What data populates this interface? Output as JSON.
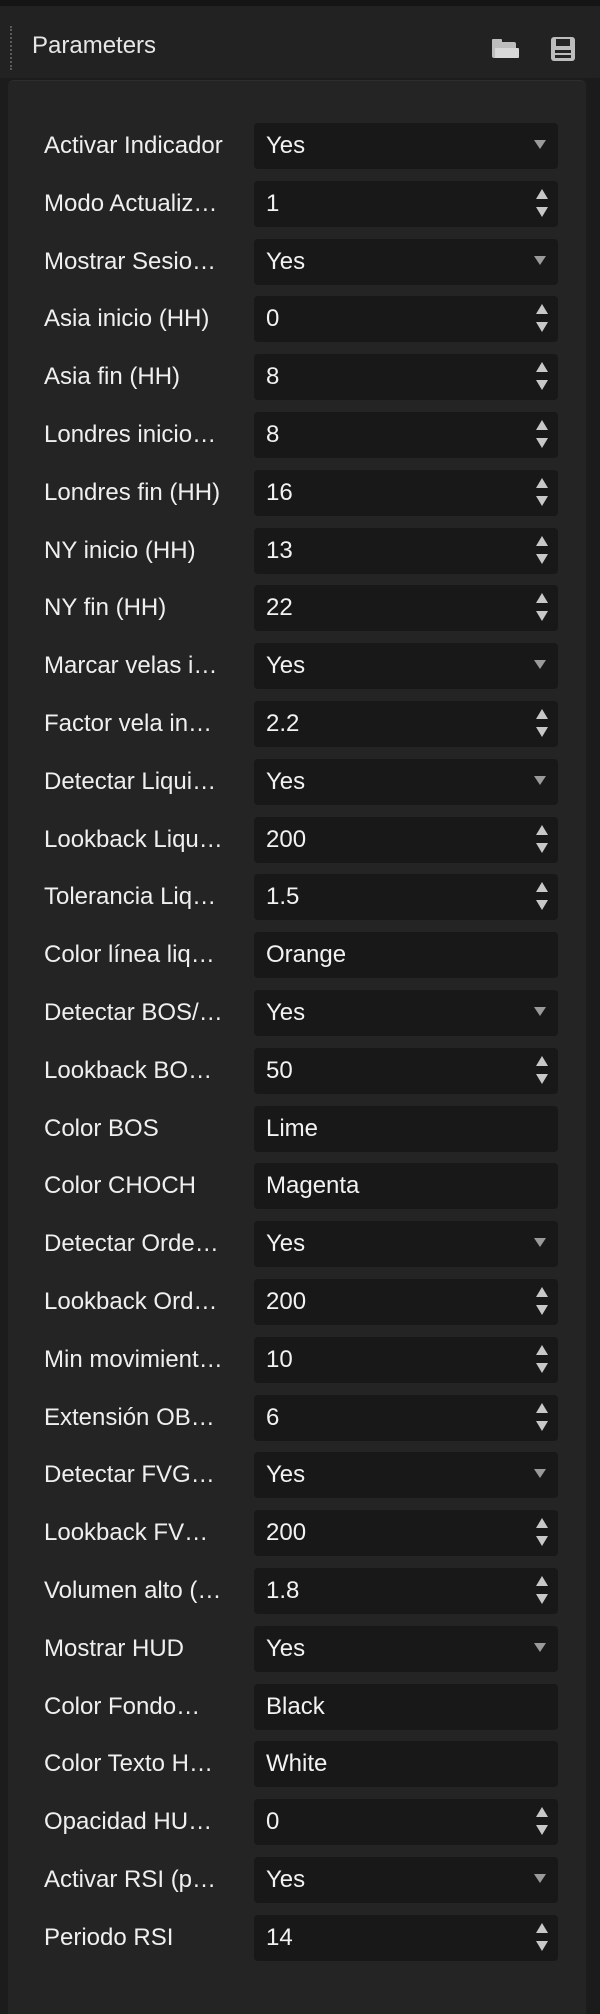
{
  "header": {
    "title": "Parameters",
    "load_icon": "folder-open-icon",
    "save_icon": "save-disk-icon"
  },
  "params": [
    {
      "label": "Activar Indicador",
      "value": "Yes",
      "type": "select"
    },
    {
      "label": "Modo Actualiz…",
      "value": "1",
      "type": "number"
    },
    {
      "label": "Mostrar Sesio…",
      "value": "Yes",
      "type": "select"
    },
    {
      "label": "Asia inicio (HH)",
      "value": "0",
      "type": "number"
    },
    {
      "label": "Asia fin (HH)",
      "value": "8",
      "type": "number"
    },
    {
      "label": "Londres inicio…",
      "value": "8",
      "type": "number"
    },
    {
      "label": "Londres fin (HH)",
      "value": "16",
      "type": "number"
    },
    {
      "label": "NY inicio (HH)",
      "value": "13",
      "type": "number"
    },
    {
      "label": "NY fin (HH)",
      "value": "22",
      "type": "number"
    },
    {
      "label": "Marcar velas i…",
      "value": "Yes",
      "type": "select"
    },
    {
      "label": "Factor vela in…",
      "value": "2.2",
      "type": "number"
    },
    {
      "label": "Detectar Liqui…",
      "value": "Yes",
      "type": "select"
    },
    {
      "label": "Lookback Liqu…",
      "value": "200",
      "type": "number"
    },
    {
      "label": "Tolerancia Liq…",
      "value": "1.5",
      "type": "number"
    },
    {
      "label": "Color línea liq…",
      "value": "Orange",
      "type": "text"
    },
    {
      "label": "Detectar BOS/…",
      "value": "Yes",
      "type": "select"
    },
    {
      "label": "Lookback BO…",
      "value": "50",
      "type": "number"
    },
    {
      "label": "Color BOS",
      "value": "Lime",
      "type": "text"
    },
    {
      "label": "Color CHOCH",
      "value": "Magenta",
      "type": "text"
    },
    {
      "label": "Detectar Orde…",
      "value": "Yes",
      "type": "select"
    },
    {
      "label": "Lookback Ord…",
      "value": "200",
      "type": "number"
    },
    {
      "label": "Min movimient…",
      "value": "10",
      "type": "number"
    },
    {
      "label": "Extensión OB…",
      "value": "6",
      "type": "number"
    },
    {
      "label": "Detectar FVG…",
      "value": "Yes",
      "type": "select"
    },
    {
      "label": "Lookback FV…",
      "value": "200",
      "type": "number"
    },
    {
      "label": "Volumen alto (…",
      "value": "1.8",
      "type": "number"
    },
    {
      "label": "Mostrar HUD",
      "value": "Yes",
      "type": "select"
    },
    {
      "label": "Color Fondo…",
      "value": "Black",
      "type": "text"
    },
    {
      "label": "Color Texto H…",
      "value": "White",
      "type": "text"
    },
    {
      "label": "Opacidad HU…",
      "value": "0",
      "type": "number"
    },
    {
      "label": "Activar RSI (p…",
      "value": "Yes",
      "type": "select"
    },
    {
      "label": "Periodo RSI",
      "value": "14",
      "type": "number"
    }
  ]
}
